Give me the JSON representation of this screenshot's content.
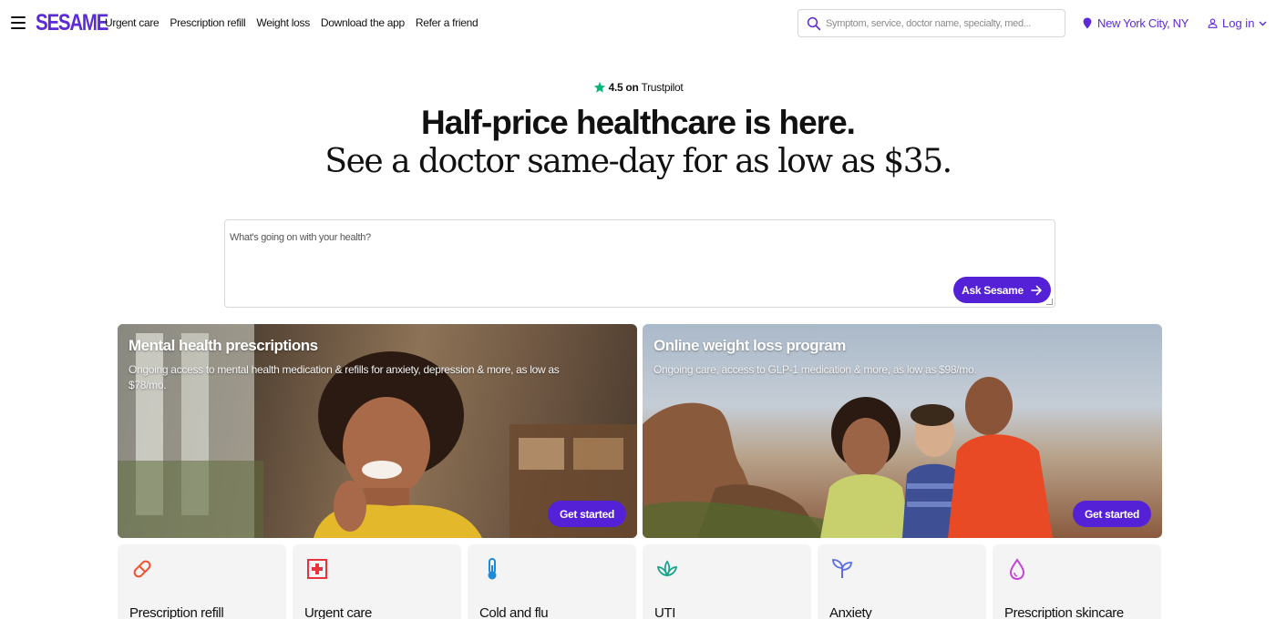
{
  "nav": {
    "logo": "SESAME",
    "links": [
      "Urgent care",
      "Prescription refill",
      "Weight loss",
      "Download the app",
      "Refer a friend"
    ],
    "search_placeholder": "Symptom, service, doctor name, specialty, med...",
    "location": "New York City, NY",
    "login": "Log in",
    "icons": {
      "menu": "hamburger-icon",
      "search": "search-icon",
      "location": "location-pin-icon",
      "user": "user-icon",
      "chevron": "chevron-down-icon"
    }
  },
  "hero": {
    "rating": "4.5 on",
    "rating_source": "Trustpilot",
    "headline": "Half-price healthcare is here.",
    "subheadline": "See a doctor same-day for as low as $35.",
    "ask_placeholder": "What's going on with your health?",
    "ask_button": "Ask Sesame"
  },
  "promos": [
    {
      "title": "Mental health prescriptions",
      "description": "Ongoing access to mental health medication & refills for anxiety, depression & more, as low as $78/mo.",
      "cta": "Get started"
    },
    {
      "title": "Online weight loss program",
      "description": "Ongoing care, access to GLP-1 medication & more, as low as $98/mo.",
      "cta": "Get started"
    }
  ],
  "services": [
    {
      "label": "Prescription refill",
      "icon": "pill-icon",
      "color": "#f0522d"
    },
    {
      "label": "Urgent care",
      "icon": "medical-cross-icon",
      "color": "#e8323c"
    },
    {
      "label": "Cold and flu",
      "icon": "thermometer-icon",
      "color": "#1f8ad8"
    },
    {
      "label": "UTI",
      "icon": "lotus-icon",
      "color": "#19a38a"
    },
    {
      "label": "Anxiety",
      "icon": "sprout-icon",
      "color": "#5b6ee8"
    },
    {
      "label": "Prescription skincare",
      "icon": "droplet-icon",
      "color": "#c544d8"
    }
  ],
  "colors": {
    "brand": "#5b2bd8",
    "button": "#5521d6",
    "trustpilot_star": "#00b67a"
  }
}
